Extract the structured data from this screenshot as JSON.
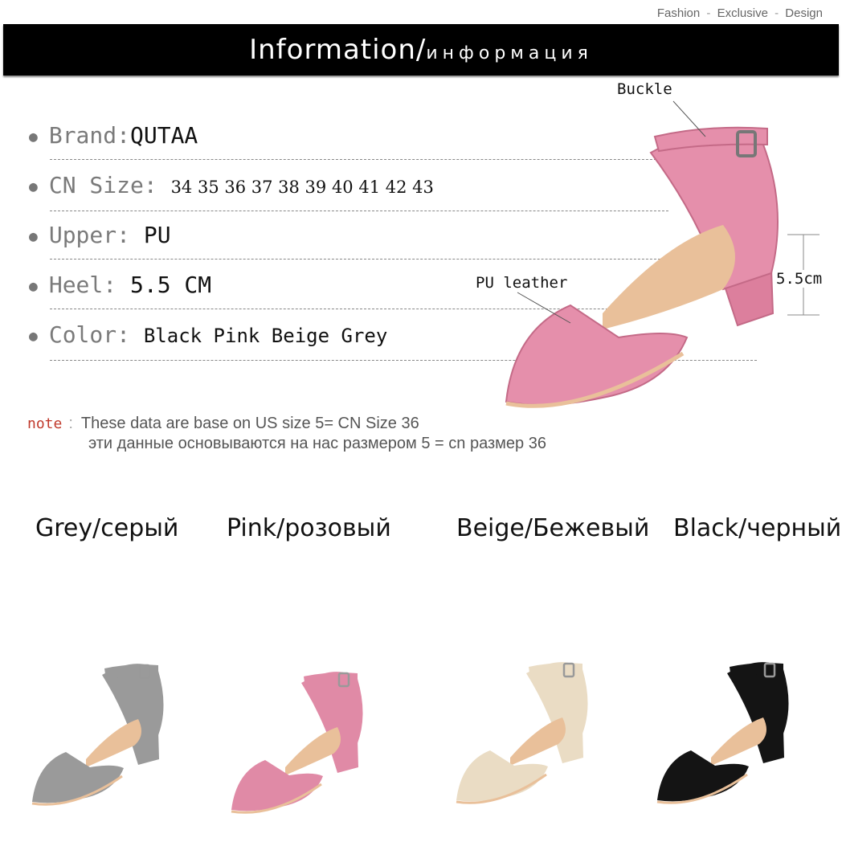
{
  "header": {
    "tagline": [
      "Fashion",
      "Exclusive",
      "Design"
    ],
    "tagline_sep": "-",
    "title_en": "Information",
    "title_slash": "/",
    "title_ru": "информация"
  },
  "specs": [
    {
      "label": "Brand:",
      "value": "QUTAA"
    },
    {
      "label": "CN Size:",
      "value": "34 35 36 37 38 39 40 41 42 43"
    },
    {
      "label": "Upper:",
      "value": "PU"
    },
    {
      "label": "Heel:",
      "value": "5.5 CM"
    },
    {
      "label": "Color:",
      "value": "Black Pink Beige Grey"
    }
  ],
  "note": {
    "label": "note",
    "colon": ":",
    "line_en": "These data are base on US size 5= CN Size 36",
    "line_ru": "эти данные основываются на нас размером 5 = cn размер 36"
  },
  "callouts": {
    "buckle": "Buckle",
    "material": "PU leather",
    "heel_height": "5.5cm"
  },
  "variants": [
    {
      "label": "Grey/серый",
      "color": "#9a9a9a"
    },
    {
      "label": "Pink/розовый",
      "color": "#e08aa6"
    },
    {
      "label": "Beige/Бежевый",
      "color": "#eadcc4"
    },
    {
      "label": "Black/черный",
      "color": "#141414"
    }
  ],
  "colors": {
    "banner": "#000000",
    "main_shoe": "#e58fab",
    "insole": "#e9c09a",
    "note_label": "#c0392b"
  }
}
